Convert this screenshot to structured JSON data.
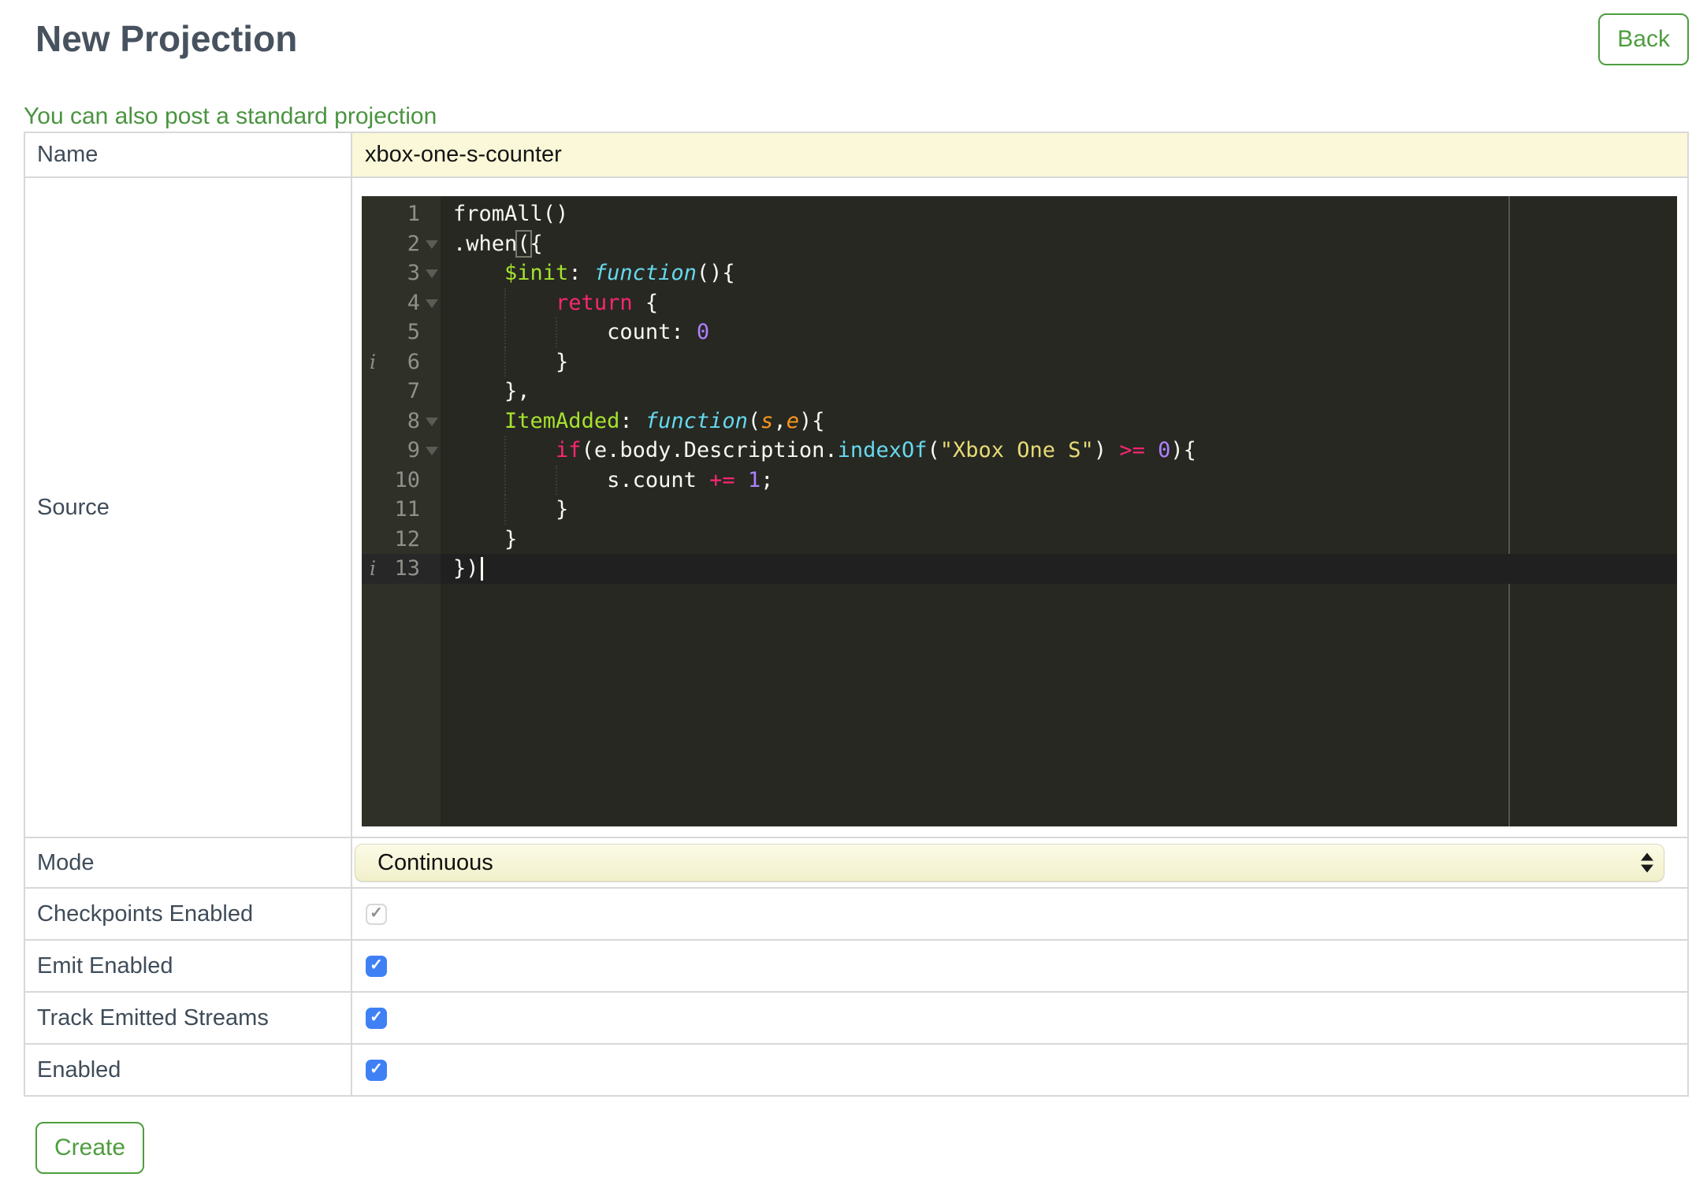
{
  "page": {
    "title": "New Projection",
    "back_label": "Back",
    "link_text": "You can also post a standard projection",
    "create_label": "Create"
  },
  "form": {
    "name": {
      "label": "Name",
      "value": "xbox-one-s-counter"
    },
    "source": {
      "label": "Source"
    },
    "mode": {
      "label": "Mode",
      "value": "Continuous"
    },
    "toggles": [
      {
        "label": "Checkpoints Enabled",
        "checked": true,
        "disabled": true
      },
      {
        "label": "Emit Enabled",
        "checked": true,
        "disabled": false
      },
      {
        "label": "Track Emitted Streams",
        "checked": true,
        "disabled": false
      },
      {
        "label": "Enabled",
        "checked": true,
        "disabled": false
      }
    ]
  },
  "icons": {
    "check_glyph": "✓",
    "annotation_glyph": "i"
  },
  "theme": {
    "green": "#4E9D3F",
    "link_green": "#4A9440",
    "title": "#47525F",
    "label": "#3F4C59",
    "border": "#D8D8D8",
    "input_yellow": "#FAF8D8",
    "select_top": "#FCFBE6",
    "select_bottom": "#F1F0CB",
    "select_border": "#D9D8B6",
    "checkbox_blue": "#3F80F5",
    "checkbox_disabled_border": "#D8D8D8",
    "check_gray": "#8F8F8F"
  },
  "editor": {
    "active_line": 13,
    "annotations": [
      6,
      13
    ],
    "folds": [
      2,
      3,
      4,
      8,
      9
    ],
    "colors": {
      "background": "#272822",
      "gutter": "#2F3129",
      "text": "#F8F8F2",
      "line_number": "#8F908A",
      "active_line": "#202020",
      "active_gutter": "#272727",
      "keyword": "#F92672",
      "entity": "#A6E22E",
      "storage": "#66D9EF",
      "support": "#66D9EF",
      "param": "#FD971F",
      "string": "#E6DB74",
      "number": "#AE81FF",
      "print_margin": "#55564F"
    },
    "lines": [
      [
        {
          "t": "fromAll()",
          "c": "p"
        }
      ],
      [
        {
          "t": ".when",
          "c": "p"
        },
        {
          "t": "(",
          "c": "p",
          "boxed": true
        },
        {
          "t": "{",
          "c": "p"
        }
      ],
      [
        {
          "t": "    ",
          "c": "p"
        },
        {
          "t": "$init",
          "c": "n"
        },
        {
          "t": ": ",
          "c": "p"
        },
        {
          "t": "function",
          "c": "f"
        },
        {
          "t": "(){",
          "c": "p"
        }
      ],
      [
        {
          "t": "        ",
          "c": "p"
        },
        {
          "t": "return",
          "c": "k"
        },
        {
          "t": " {",
          "c": "p"
        }
      ],
      [
        {
          "t": "            count: ",
          "c": "p"
        },
        {
          "t": "0",
          "c": "num"
        }
      ],
      [
        {
          "t": "        }",
          "c": "p"
        }
      ],
      [
        {
          "t": "    },",
          "c": "p"
        }
      ],
      [
        {
          "t": "    ",
          "c": "p"
        },
        {
          "t": "ItemAdded",
          "c": "n"
        },
        {
          "t": ": ",
          "c": "p"
        },
        {
          "t": "function",
          "c": "f"
        },
        {
          "t": "(",
          "c": "p"
        },
        {
          "t": "s",
          "c": "pa"
        },
        {
          "t": ",",
          "c": "p"
        },
        {
          "t": "e",
          "c": "pa"
        },
        {
          "t": "){",
          "c": "p"
        }
      ],
      [
        {
          "t": "        ",
          "c": "p"
        },
        {
          "t": "if",
          "c": "k"
        },
        {
          "t": "(e.body.Description.",
          "c": "p"
        },
        {
          "t": "indexOf",
          "c": "su"
        },
        {
          "t": "(",
          "c": "p"
        },
        {
          "t": "\"Xbox One S\"",
          "c": "s"
        },
        {
          "t": ") ",
          "c": "p"
        },
        {
          "t": ">=",
          "c": "k"
        },
        {
          "t": " ",
          "c": "p"
        },
        {
          "t": "0",
          "c": "num"
        },
        {
          "t": "){",
          "c": "p"
        }
      ],
      [
        {
          "t": "            s.count ",
          "c": "p"
        },
        {
          "t": "+=",
          "c": "k"
        },
        {
          "t": " ",
          "c": "p"
        },
        {
          "t": "1",
          "c": "num"
        },
        {
          "t": ";",
          "c": "p"
        }
      ],
      [
        {
          "t": "        }",
          "c": "p"
        }
      ],
      [
        {
          "t": "    }",
          "c": "p"
        }
      ],
      [
        {
          "t": "})",
          "c": "p"
        },
        {
          "cursor": true
        }
      ]
    ]
  }
}
